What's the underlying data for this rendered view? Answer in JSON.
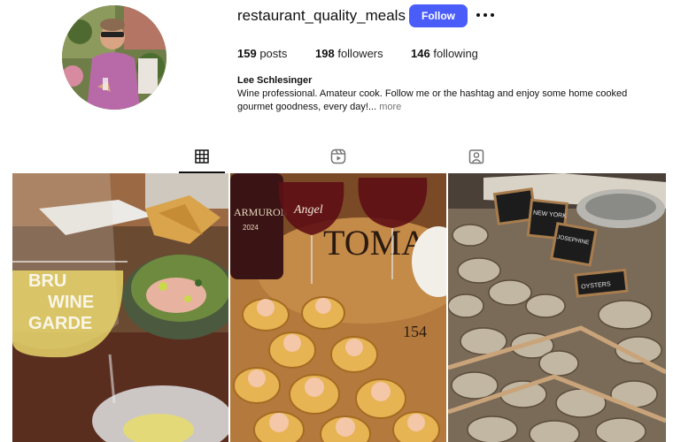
{
  "profile": {
    "username": "restaurant_quality_meals",
    "follow_label": "Follow",
    "posts_count": "159",
    "posts_label": "posts",
    "followers_count": "198",
    "followers_label": "followers",
    "following_count": "146",
    "following_label": "following",
    "display_name": "Lee Schlesinger",
    "bio": "Wine professional. Amateur cook. Follow me or the hashtag and enjoy some home cooked gourmet goodness, every day!...",
    "bio_more": "more"
  },
  "tabs": [
    {
      "icon": "grid-icon",
      "active": true
    },
    {
      "icon": "reels-icon",
      "active": false
    },
    {
      "icon": "tagged-icon",
      "active": false
    }
  ],
  "posts": [
    {
      "image": "wine-glass-and-ceviche",
      "glass_text": [
        "BRU",
        "WINE",
        "GARDE"
      ]
    },
    {
      "image": "red-wine-and-shrimp-pastries",
      "glass_text": "Angel",
      "bottle_text": "ARMURON",
      "bottle_year": "2024",
      "barrel_text": [
        "TOMA",
        "154"
      ]
    },
    {
      "image": "oyster-market-display",
      "signs": [
        "NEW YORK",
        "JOSEPHINE",
        "OYSTERS"
      ]
    }
  ],
  "colors": {
    "accent": "#4a5df9",
    "muted": "#737373"
  }
}
